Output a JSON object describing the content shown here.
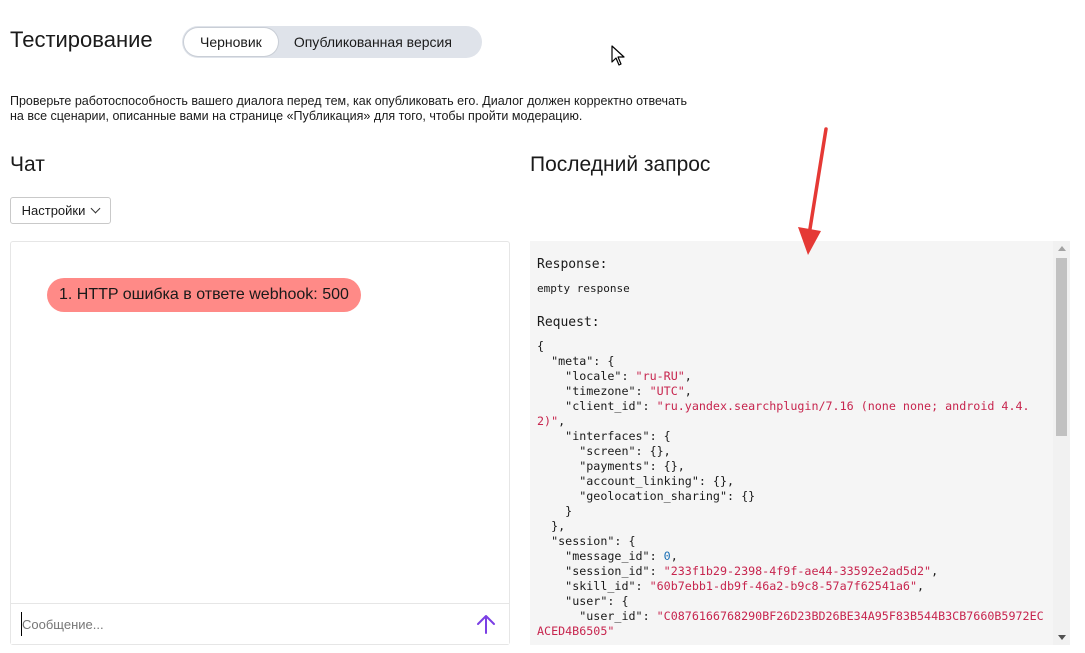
{
  "header": {
    "title": "Тестирование",
    "tabs": [
      {
        "label": "Черновик",
        "active": true
      },
      {
        "label": "Опубликованная версия",
        "active": false
      }
    ]
  },
  "description": "Проверьте работоспособность вашего диалога перед тем, как опубликовать его. Диалог должен корректно отвечать на все сценарии, описанные вами на странице «Публикация» для того, чтобы пройти модерацию.",
  "chat": {
    "title": "Чат",
    "settings_label": "Настройки",
    "error_message": "1. HTTP ошибка в ответе webhook: 500",
    "input_placeholder": "Сообщение...",
    "send_icon": "arrow-up-icon"
  },
  "request": {
    "title": "Последний запрос",
    "response_label": "Response:",
    "response_value": "empty response",
    "request_label": "Request:",
    "json": [
      {
        "t": "{"
      },
      {
        "t": "  \"meta\": {"
      },
      {
        "t": "    \"locale\": ",
        "s": "\"ru-RU\"",
        "e": ","
      },
      {
        "t": "    \"timezone\": ",
        "s": "\"UTC\"",
        "e": ","
      },
      {
        "t": "    \"client_id\": ",
        "s": "\"ru.yandex.searchplugin/7.16 (none none; android 4.4.2)\"",
        "e": ","
      },
      {
        "t": "    \"interfaces\": {"
      },
      {
        "t": "      \"screen\": {},"
      },
      {
        "t": "      \"payments\": {},"
      },
      {
        "t": "      \"account_linking\": {},"
      },
      {
        "t": "      \"geolocation_sharing\": {}"
      },
      {
        "t": "    }"
      },
      {
        "t": "  },"
      },
      {
        "t": "  \"session\": {"
      },
      {
        "t": "    \"message_id\": ",
        "n": "0",
        "e": ","
      },
      {
        "t": "    \"session_id\": ",
        "s": "\"233f1b29-2398-4f9f-ae44-33592e2ad5d2\"",
        "e": ","
      },
      {
        "t": "    \"skill_id\": ",
        "s": "\"60b7ebb1-db9f-46a2-b9c8-57a7f62541a6\"",
        "e": ","
      },
      {
        "t": "    \"user\": {"
      },
      {
        "t": "      \"user_id\": ",
        "s": "\"C0876166768290BF26D23BD26BE34A95F83B544B3CB7660B5972ECACED4B6505\""
      }
    ]
  },
  "colors": {
    "error_bubble": "#ff8a87",
    "json_string": "#c7254e",
    "json_number": "#1a6fb5",
    "send_icon": "#7b3fe4",
    "annotation_arrow": "#e53935"
  }
}
